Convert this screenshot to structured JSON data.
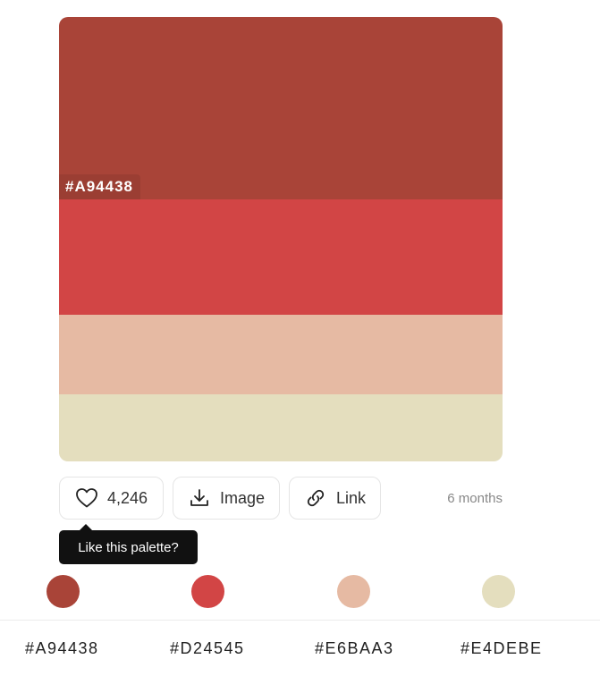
{
  "palette": {
    "colors": [
      "#A94438",
      "#D24545",
      "#E6BAA3",
      "#E4DEBE"
    ],
    "hover_hex_label": "#A94438"
  },
  "actions": {
    "likes_count": "4,246",
    "image_label": "Image",
    "link_label": "Link",
    "time_ago": "6 months"
  },
  "tooltip": {
    "text": "Like this palette?"
  },
  "swatch_list": [
    {
      "hex": "#A94438"
    },
    {
      "hex": "#D24545"
    },
    {
      "hex": "#E6BAA3"
    },
    {
      "hex": "#E4DEBE"
    }
  ]
}
